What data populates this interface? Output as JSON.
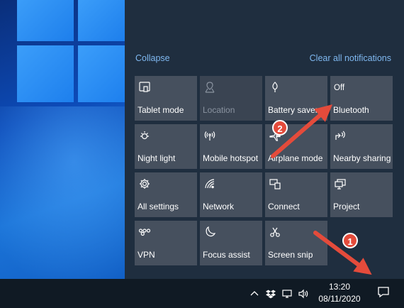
{
  "header": {
    "collapse_label": "Collapse",
    "clear_label": "Clear all notifications"
  },
  "tiles": [
    {
      "label": "Tablet mode",
      "icon": "tablet-mode-icon",
      "state": ""
    },
    {
      "label": "Location",
      "icon": "location-icon",
      "state": "",
      "disabled": true
    },
    {
      "label": "Battery saver",
      "icon": "battery-saver-icon",
      "state": ""
    },
    {
      "label": "Bluetooth",
      "icon": "bluetooth-icon",
      "state": "Off"
    },
    {
      "label": "Night light",
      "icon": "night-light-icon",
      "state": ""
    },
    {
      "label": "Mobile hotspot",
      "icon": "mobile-hotspot-icon",
      "state": ""
    },
    {
      "label": "Airplane mode",
      "icon": "airplane-icon",
      "state": ""
    },
    {
      "label": "Nearby sharing",
      "icon": "nearby-sharing-icon",
      "state": ""
    },
    {
      "label": "All settings",
      "icon": "gear-icon",
      "state": ""
    },
    {
      "label": "Network",
      "icon": "network-icon",
      "state": ""
    },
    {
      "label": "Connect",
      "icon": "connect-icon",
      "state": ""
    },
    {
      "label": "Project",
      "icon": "project-icon",
      "state": ""
    },
    {
      "label": "VPN",
      "icon": "vpn-icon",
      "state": ""
    },
    {
      "label": "Focus assist",
      "icon": "moon-icon",
      "state": ""
    },
    {
      "label": "Screen snip",
      "icon": "screen-snip-icon",
      "state": ""
    }
  ],
  "taskbar": {
    "time": "13:20",
    "date": "08/11/2020",
    "tray_icons": [
      "chevron-up-icon",
      "dropbox-icon",
      "network-icon",
      "volume-icon"
    ]
  },
  "annotations": [
    {
      "number": "1",
      "target": "notification-button"
    },
    {
      "number": "2",
      "target": "bluetooth-tile"
    }
  ],
  "colors": {
    "action_center_bg": "#1f2e3f",
    "tile_bg": "#46505e",
    "link": "#7fb8f0",
    "annotation": "#e44b3b"
  }
}
